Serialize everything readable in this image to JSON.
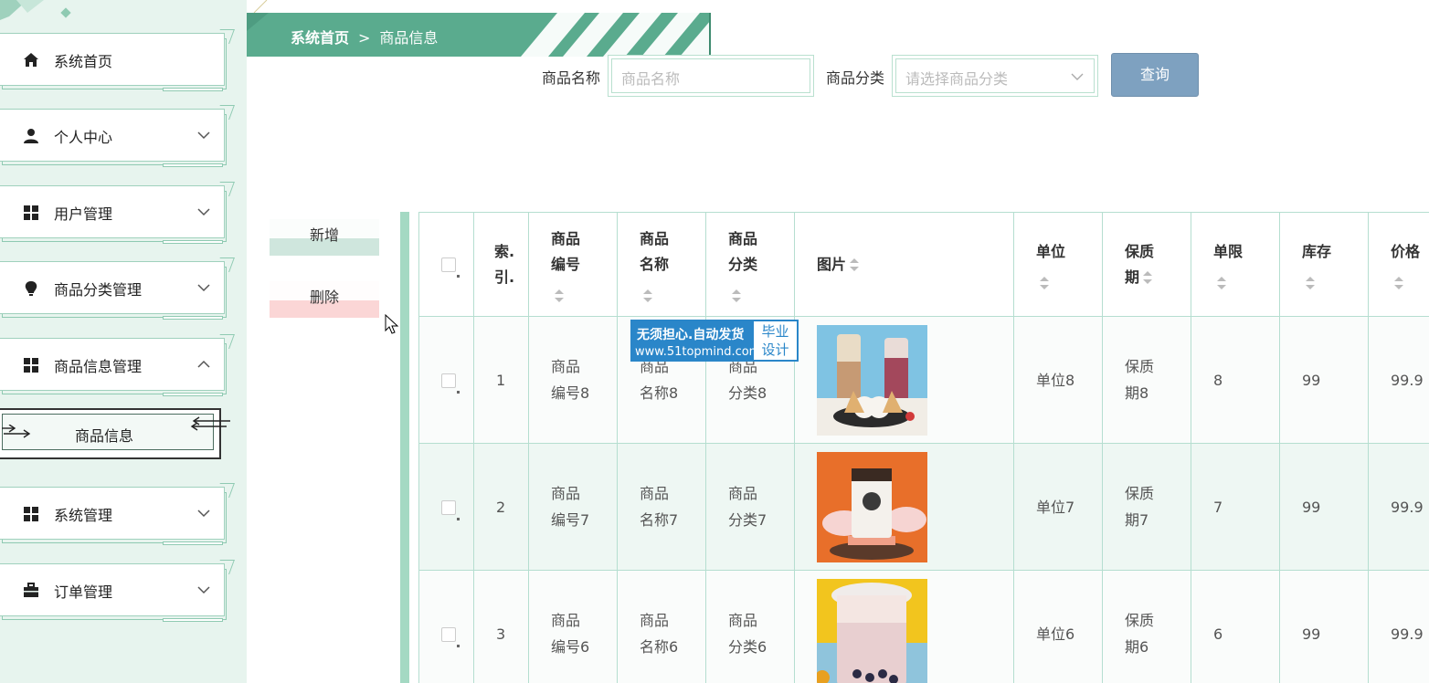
{
  "sidebar": {
    "items": [
      {
        "label": "系统首页",
        "icon": "home-icon",
        "has_chevron": false
      },
      {
        "label": "个人中心",
        "icon": "user-icon",
        "has_chevron": true,
        "chevron": "down"
      },
      {
        "label": "用户管理",
        "icon": "grid-icon",
        "has_chevron": true,
        "chevron": "down"
      },
      {
        "label": "商品分类管理",
        "icon": "bulb-icon",
        "has_chevron": true,
        "chevron": "down"
      },
      {
        "label": "商品信息管理",
        "icon": "grid-icon",
        "has_chevron": true,
        "chevron": "up"
      },
      {
        "label": "系统管理",
        "icon": "grid-icon",
        "has_chevron": true,
        "chevron": "down"
      },
      {
        "label": "订单管理",
        "icon": "briefcase-icon",
        "has_chevron": true,
        "chevron": "down"
      }
    ],
    "sub_item": {
      "label": "商品信息"
    }
  },
  "breadcrumb": {
    "home": "系统首页",
    "separator": ">",
    "current": "商品信息"
  },
  "search": {
    "name_label": "商品名称",
    "name_placeholder": "商品名称",
    "category_label": "商品分类",
    "category_placeholder": "请选择商品分类",
    "query_button": "查询"
  },
  "actions": {
    "add": "新增",
    "delete": "删除"
  },
  "table": {
    "headers": {
      "index_line1": "索.",
      "index_line2": "引.",
      "code_line1": "商品",
      "code_line2": "编号",
      "name_line1": "商品",
      "name_line2": "名称",
      "category_line1": "商品",
      "category_line2": "分类",
      "image": "图片",
      "unit": "单位",
      "shelf_line1": "保质",
      "shelf_line2": "期",
      "limit": "单限",
      "stock": "库存",
      "price": "价格"
    },
    "rows": [
      {
        "index": "1",
        "code_line1": "商品",
        "code_line2": "编号8",
        "name_line1": "商品",
        "name_line2": "名称8",
        "category_line1": "商品",
        "category_line2": "分类8",
        "image": "milk-tea-ice-cream-photo",
        "unit": "单位8",
        "shelf_line1": "保质",
        "shelf_line2": "期8",
        "limit": "8",
        "stock": "99",
        "price": "99.9"
      },
      {
        "index": "2",
        "code_line1": "商品",
        "code_line2": "编号7",
        "name_line1": "商品",
        "name_line2": "名称7",
        "category_line1": "商品",
        "category_line2": "分类7",
        "image": "milk-tea-cup-photo",
        "unit": "单位7",
        "shelf_line1": "保质",
        "shelf_line2": "期7",
        "limit": "7",
        "stock": "99",
        "price": "99.9"
      },
      {
        "index": "3",
        "code_line1": "商品",
        "code_line2": "编号6",
        "name_line1": "商品",
        "name_line2": "名称6",
        "category_line1": "商品",
        "category_line2": "分类6",
        "image": "bubble-tea-photo",
        "unit": "单位6",
        "shelf_line1": "保质",
        "shelf_line2": "期6",
        "limit": "6",
        "stock": "99",
        "price": "99.9"
      }
    ]
  },
  "watermark": {
    "line1": "无须担心.自动发货",
    "line2": "www.51topmind.com",
    "right_line1": "毕业",
    "right_line2": "设计"
  },
  "colors": {
    "sidebar_bg": "#e7f4ee",
    "accent": "#5aab8e",
    "query_button": "#7ea1c0",
    "table_border": "#b5ded0"
  }
}
